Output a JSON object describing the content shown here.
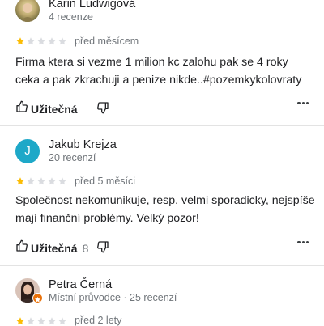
{
  "reviews": [
    {
      "author": "Karin Ludwigová",
      "meta": "4 recenze",
      "rating": 1,
      "max_rating": 5,
      "time": "před měsícem",
      "text": "Firma ktera si vezme 1 milion kc zalohu pak se 4 roky ceka a pak zkrachuji a penize nikde..#pozemkykolovraty",
      "helpful_label": "Užitečná",
      "helpful_count": ""
    },
    {
      "author": "Jakub Krejza",
      "avatar_letter": "J",
      "meta": "20 recenzí",
      "rating": 1,
      "max_rating": 5,
      "time": "před 5 měsíci",
      "text": "Společnost nekomunikuje, resp. velmi sporadicky, nejspíše mají finanční problémy. Velký pozor!",
      "helpful_label": "Užitečná",
      "helpful_count": "8"
    },
    {
      "author": "Petra Černá",
      "meta": "Místní průvodce · 25 recenzí",
      "rating": 1,
      "max_rating": 5,
      "time": "před 2 lety"
    }
  ],
  "colors": {
    "star_filled": "#fbbc04",
    "star_empty": "#dadce0",
    "avatar_bg": "#1ea8c8",
    "local_guide_badge": "#e8710a"
  },
  "icons": {
    "like": "thumb-up-outline-icon",
    "dislike": "thumb-down-outline-icon",
    "more": "more-horizontal-icon",
    "local_guide": "local-guide-star-icon"
  }
}
